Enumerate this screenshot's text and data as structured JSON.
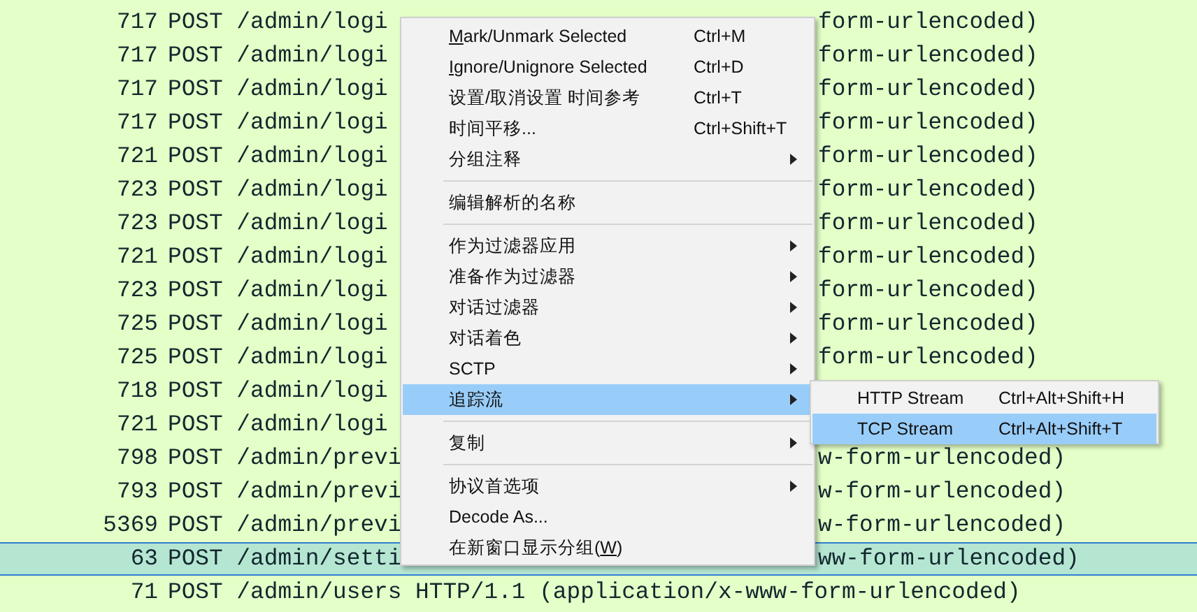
{
  "packets": [
    {
      "number": "717",
      "info_left": "POST /admin/logi",
      "info_right": "form-urlencoded)",
      "selected": false
    },
    {
      "number": "717",
      "info_left": "POST /admin/logi",
      "info_right": "form-urlencoded)",
      "selected": false
    },
    {
      "number": "717",
      "info_left": "POST /admin/logi",
      "info_right": "form-urlencoded)",
      "selected": false
    },
    {
      "number": "717",
      "info_left": "POST /admin/logi",
      "info_right": "form-urlencoded)",
      "selected": false
    },
    {
      "number": "721",
      "info_left": "POST /admin/logi",
      "info_right": "form-urlencoded)",
      "selected": false
    },
    {
      "number": "723",
      "info_left": "POST /admin/logi",
      "info_right": "form-urlencoded)",
      "selected": false
    },
    {
      "number": "723",
      "info_left": "POST /admin/logi",
      "info_right": "form-urlencoded)",
      "selected": false
    },
    {
      "number": "721",
      "info_left": "POST /admin/logi",
      "info_right": "form-urlencoded)",
      "selected": false
    },
    {
      "number": "723",
      "info_left": "POST /admin/logi",
      "info_right": "form-urlencoded)",
      "selected": false
    },
    {
      "number": "725",
      "info_left": "POST /admin/logi",
      "info_right": "form-urlencoded)",
      "selected": false
    },
    {
      "number": "725",
      "info_left": "POST /admin/logi",
      "info_right": "form-urlencoded)",
      "selected": false
    },
    {
      "number": "718",
      "info_left": "POST /admin/logi",
      "selected": false
    },
    {
      "number": "721",
      "info_left": "POST /admin/logi",
      "selected": false
    },
    {
      "number": "798",
      "info_left": "POST /admin/previ",
      "info_right": "w-form-urlencoded)",
      "selected": false
    },
    {
      "number": "793",
      "info_left": "POST /admin/previ",
      "info_right": "w-form-urlencoded)",
      "selected": false
    },
    {
      "number": "5369",
      "info_left": "POST /admin/previ",
      "info_right": "w-form-urlencoded)",
      "selected": false
    },
    {
      "number": "63",
      "info_left": "POST /admin/setti",
      "info_right": "ww-form-urlencoded)",
      "selected": true
    },
    {
      "number": "71",
      "info": "POST /admin/users HTTP/1.1  (application/x-www-form-urlencoded)",
      "selected": false
    }
  ],
  "context_menu": {
    "items": [
      {
        "kind": "item",
        "label": [
          {
            "text": "M",
            "underline": true
          },
          {
            "text": "ark/Unmark Selected",
            "underline": false
          }
        ],
        "shortcut": "Ctrl+M",
        "submenu": false,
        "selected": false
      },
      {
        "kind": "item",
        "label": [
          {
            "text": "I",
            "underline": true
          },
          {
            "text": "gnore/Unignore Selected",
            "underline": false
          }
        ],
        "shortcut": "Ctrl+D",
        "submenu": false,
        "selected": false
      },
      {
        "kind": "item",
        "label": "设置/取消设置 时间参考",
        "shortcut": "Ctrl+T",
        "submenu": false,
        "selected": false
      },
      {
        "kind": "item",
        "label": "时间平移...",
        "shortcut": "Ctrl+Shift+T",
        "submenu": false,
        "selected": false
      },
      {
        "kind": "item",
        "label": "分组注释",
        "submenu": true,
        "selected": false
      },
      {
        "kind": "separator"
      },
      {
        "kind": "item",
        "label": "编辑解析的名称",
        "submenu": false,
        "selected": false
      },
      {
        "kind": "separator"
      },
      {
        "kind": "item",
        "label": "作为过滤器应用",
        "submenu": true,
        "selected": false
      },
      {
        "kind": "item",
        "label": "准备作为过滤器",
        "submenu": true,
        "selected": false
      },
      {
        "kind": "item",
        "label": "对话过滤器",
        "submenu": true,
        "selected": false
      },
      {
        "kind": "item",
        "label": "对话着色",
        "submenu": true,
        "selected": false
      },
      {
        "kind": "item",
        "label": "SCTP",
        "submenu": true,
        "selected": false
      },
      {
        "kind": "item",
        "label": "追踪流",
        "submenu": true,
        "selected": true
      },
      {
        "kind": "separator"
      },
      {
        "kind": "item",
        "label": "复制",
        "submenu": true,
        "selected": false
      },
      {
        "kind": "separator"
      },
      {
        "kind": "item",
        "label": "协议首选项",
        "submenu": true,
        "selected": false
      },
      {
        "kind": "item",
        "label": "Decode As...",
        "submenu": false,
        "selected": false
      },
      {
        "kind": "item",
        "label": [
          {
            "text": "在新窗口显示分组(",
            "underline": false
          },
          {
            "text": "W",
            "underline": true
          },
          {
            "text": ")",
            "underline": false
          }
        ],
        "submenu": false,
        "selected": false
      }
    ]
  },
  "submenu": {
    "items": [
      {
        "kind": "item",
        "label": "HTTP Stream",
        "shortcut": "Ctrl+Alt+Shift+H",
        "selected": false
      },
      {
        "kind": "item",
        "label": "TCP Stream",
        "shortcut": "Ctrl+Alt+Shift+T",
        "selected": true
      }
    ]
  }
}
